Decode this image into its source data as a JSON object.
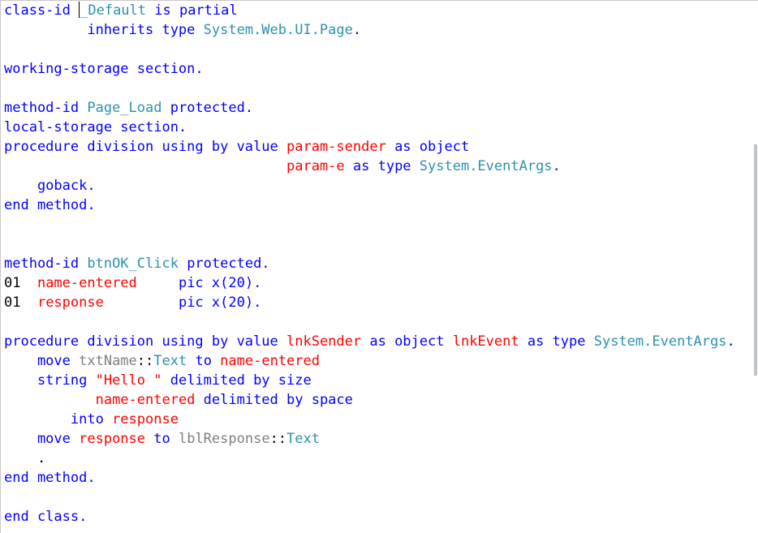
{
  "editor": {
    "lines": [
      [
        {
          "c": "k",
          "t": "class-id "
        },
        {
          "c": "cursor"
        },
        {
          "c": "t",
          "t": "_Default"
        },
        {
          "c": "k",
          "t": " is partial"
        }
      ],
      [
        {
          "c": "k",
          "t": "          inherits type "
        },
        {
          "c": "t",
          "t": "System.Web.UI.Page"
        },
        {
          "c": "k",
          "t": "."
        }
      ],
      [],
      [
        {
          "c": "k",
          "t": "working-storage section."
        }
      ],
      [],
      [
        {
          "c": "k",
          "t": "method-id "
        },
        {
          "c": "t",
          "t": "Page_Load"
        },
        {
          "c": "k",
          "t": " protected."
        }
      ],
      [
        {
          "c": "k",
          "t": "local-storage section."
        }
      ],
      [
        {
          "c": "k",
          "t": "procedure division using by value "
        },
        {
          "c": "v",
          "t": "param-sender"
        },
        {
          "c": "k",
          "t": " as object"
        }
      ],
      [
        {
          "c": "k",
          "t": "                                  "
        },
        {
          "c": "v",
          "t": "param-e"
        },
        {
          "c": "k",
          "t": " as type "
        },
        {
          "c": "t",
          "t": "System.EventArgs"
        },
        {
          "c": "k",
          "t": "."
        }
      ],
      [
        {
          "c": "k",
          "t": "    goback."
        }
      ],
      [
        {
          "c": "k",
          "t": "end method."
        }
      ],
      [],
      [],
      [
        {
          "c": "k",
          "t": "method-id "
        },
        {
          "c": "t",
          "t": "btnOK_Click"
        },
        {
          "c": "k",
          "t": " protected."
        }
      ],
      [
        {
          "c": "bk",
          "t": "01  "
        },
        {
          "c": "v",
          "t": "name-entered"
        },
        {
          "c": "k",
          "t": "     pic x(20)."
        }
      ],
      [
        {
          "c": "bk",
          "t": "01  "
        },
        {
          "c": "v",
          "t": "response"
        },
        {
          "c": "k",
          "t": "         pic x(20)."
        }
      ],
      [],
      [
        {
          "c": "k",
          "t": "procedure division using by value "
        },
        {
          "c": "v",
          "t": "lnkSender"
        },
        {
          "c": "k",
          "t": " as object "
        },
        {
          "c": "v",
          "t": "lnkEvent"
        },
        {
          "c": "k",
          "t": " as type "
        },
        {
          "c": "t",
          "t": "System.EventArgs"
        },
        {
          "c": "k",
          "t": "."
        }
      ],
      [
        {
          "c": "k",
          "t": "    move "
        },
        {
          "c": "g",
          "t": "txtName"
        },
        {
          "c": "bk",
          "t": "::"
        },
        {
          "c": "t",
          "t": "Text"
        },
        {
          "c": "k",
          "t": " to "
        },
        {
          "c": "v",
          "t": "name-entered"
        }
      ],
      [
        {
          "c": "k",
          "t": "    string "
        },
        {
          "c": "v",
          "t": "\"Hello \""
        },
        {
          "c": "k",
          "t": " delimited by size"
        }
      ],
      [
        {
          "c": "k",
          "t": "           "
        },
        {
          "c": "v",
          "t": "name-entered"
        },
        {
          "c": "k",
          "t": " delimited by space"
        }
      ],
      [
        {
          "c": "k",
          "t": "        into "
        },
        {
          "c": "v",
          "t": "response"
        }
      ],
      [
        {
          "c": "k",
          "t": "    move "
        },
        {
          "c": "v",
          "t": "response"
        },
        {
          "c": "k",
          "t": " to "
        },
        {
          "c": "g",
          "t": "lblResponse"
        },
        {
          "c": "bk",
          "t": "::"
        },
        {
          "c": "t",
          "t": "Text"
        }
      ],
      [
        {
          "c": "bk",
          "t": "    ."
        }
      ],
      [
        {
          "c": "k",
          "t": "end method."
        }
      ],
      [],
      [
        {
          "c": "k",
          "t": "end class."
        }
      ]
    ]
  }
}
